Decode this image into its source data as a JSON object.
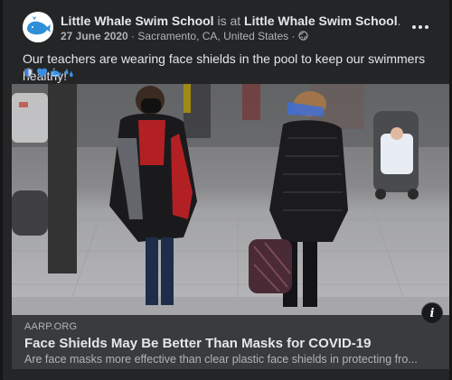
{
  "post": {
    "page_name": "Little Whale Swim School",
    "is_at_text": "is at",
    "location_name": "Little Whale Swim School",
    "title_suffix": ".",
    "date": "27 June 2020",
    "separator": " · ",
    "place": "Sacramento, CA, United States",
    "privacy_separator": " · ",
    "privacy_icon": "globe-icon",
    "more_icon": "more-options-icon",
    "text": "Our teachers are wearing face shields in the pool to keep our swimmers healthy!",
    "emojis": [
      "shield-emoji",
      "blue-heart-emoji",
      "whale-emoji",
      "droplets-emoji"
    ]
  },
  "link_preview": {
    "domain": "AARP.ORG",
    "headline": "Face Shields May Be Better Than Masks for COVID-19",
    "description": "Are face masks more effective than clear plastic face shields in protecting fro...",
    "info_icon": "info-icon",
    "info_glyph": "i"
  },
  "colors": {
    "background": "#161617",
    "card": "#242526",
    "link_bar": "#3a3b3c",
    "primary_text": "#e4e6eb",
    "secondary_text": "#b0b3b8",
    "emoji_blue": "#3b8fe0"
  }
}
